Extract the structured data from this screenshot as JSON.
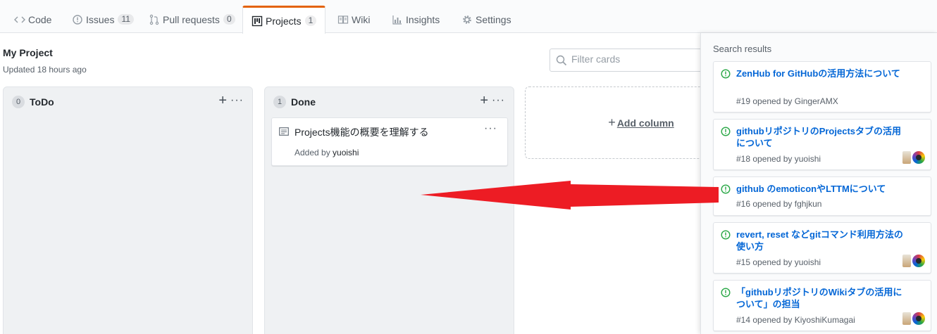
{
  "tabs": [
    {
      "icon": "code-icon",
      "label": "Code",
      "count": ""
    },
    {
      "icon": "issue-opened-icon",
      "label": "Issues",
      "count": "11"
    },
    {
      "icon": "git-pull-request-icon",
      "label": "Pull requests",
      "count": "0"
    },
    {
      "icon": "project-icon",
      "label": "Projects",
      "count": "1"
    },
    {
      "icon": "book-icon",
      "label": "Wiki",
      "count": ""
    },
    {
      "icon": "graph-icon",
      "label": "Insights",
      "count": ""
    },
    {
      "icon": "gear-icon",
      "label": "Settings",
      "count": ""
    }
  ],
  "project": {
    "title": "My Project",
    "updated": "Updated 18 hours ago",
    "filter_placeholder": "Filter cards"
  },
  "columns": [
    {
      "name": "ToDo",
      "count": "0",
      "cards": []
    },
    {
      "name": "Done",
      "count": "1",
      "cards": [
        {
          "text": "Projects機能の概要を理解する",
          "meta_prefix": "Added by ",
          "author": "yuoishi"
        }
      ]
    }
  ],
  "add_column_label": "Add column",
  "sidebar": {
    "title": "Search results",
    "results": [
      {
        "title": "ZenHub for GitHubの活用方法について",
        "meta": "#19 opened by GingerAMX"
      },
      {
        "title": "githubリポジトリのProjectsタブの活用について",
        "meta": "#18 opened by yuoishi"
      },
      {
        "title": "github のemoticonやLTTMについて",
        "meta": "#16 opened by fghjkun"
      },
      {
        "title": "revert, reset などgitコマンド利用方法の使い方",
        "meta": "#15 opened by yuoishi"
      },
      {
        "title": "「githubリポジトリのWikiタブの活用について」の担当",
        "meta": "#14 opened by KiyoshiKumagai"
      }
    ]
  },
  "colors": {
    "accent_tab": "#e36209",
    "link": "#0366d6",
    "issue_open": "#28a745",
    "annotation_arrow": "#ed1c24"
  }
}
